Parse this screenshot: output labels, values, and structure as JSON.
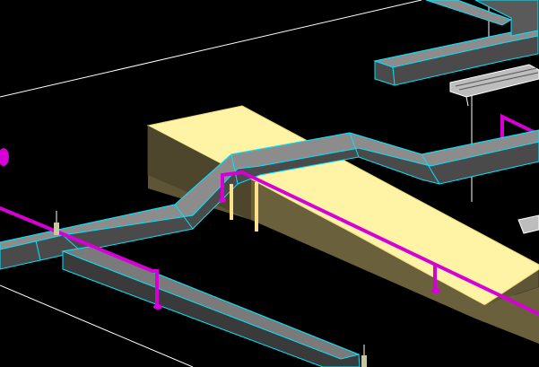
{
  "viewport": {
    "background": "#000000",
    "colors": {
      "duct_top": "#8c8c8c",
      "duct_side": "#4a4a4a",
      "duct_edge": "#00e5ff",
      "beam_top": "#fff3a6",
      "beam_side": "#5e5436",
      "beam_front": "#6b603c",
      "pipe": "#d600d6",
      "wire": "#ffffff",
      "tray": "#bdbdbd",
      "support": "#ffe08a"
    },
    "icons": [
      "pipe-hanger-icon",
      "support-rod-icon"
    ]
  }
}
